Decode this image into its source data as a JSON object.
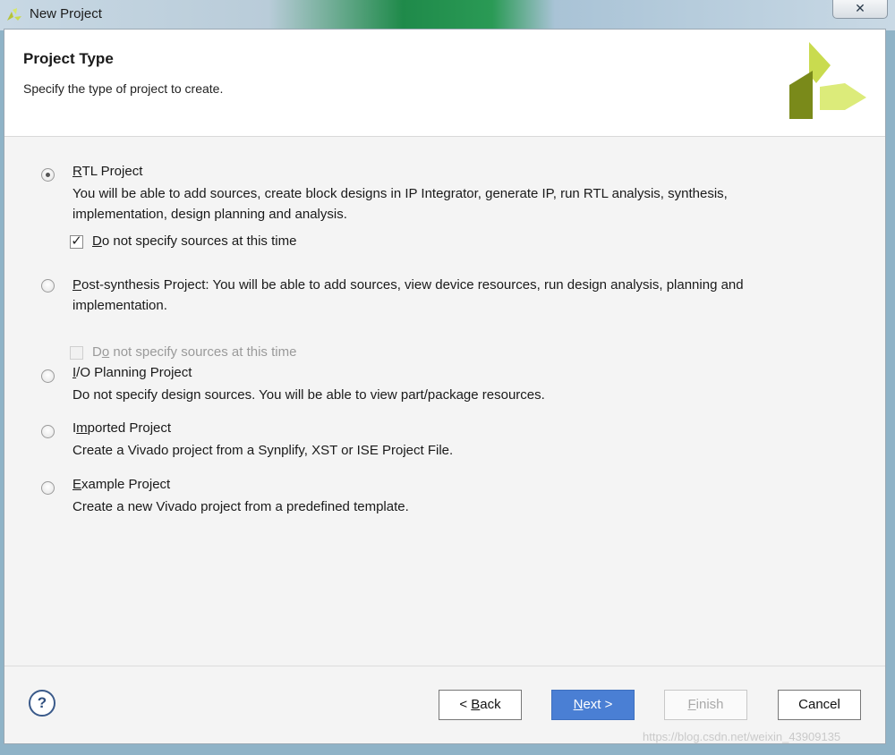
{
  "window": {
    "title": "New Project",
    "close_glyph": "✕"
  },
  "header": {
    "title": "Project Type",
    "subtitle": "Specify the type of project to create.",
    "logo_icon": "vivado-logo-icon"
  },
  "options": [
    {
      "key": "R",
      "title_rest": "TL Project",
      "desc": "You will be able to add sources, create block designs in IP Integrator, generate IP, run RTL analysis, synthesis, implementation, design planning and analysis.",
      "selected": true,
      "checkbox": {
        "key": "D",
        "label_rest": "o not specify sources at this time",
        "checked": true,
        "enabled": true
      }
    },
    {
      "key": "P",
      "title_rest": "ost-synthesis Project: You will be able to add sources, view device resources, run design analysis, planning and implementation.",
      "selected": false,
      "checkbox": {
        "pre": "D",
        "key": "o",
        "label_rest": " not specify sources at this time",
        "checked": false,
        "enabled": false
      }
    },
    {
      "key": "I",
      "title_rest": "/O Planning Project",
      "desc": "Do not specify design sources. You will be able to view part/package resources.",
      "selected": false
    },
    {
      "pre": "I",
      "key": "m",
      "title_rest": "ported Project",
      "desc": "Create a Vivado project from a Synplify, XST or ISE Project File.",
      "selected": false
    },
    {
      "key": "E",
      "title_rest": "xample Project",
      "desc": "Create a new Vivado project from a predefined template.",
      "selected": false
    }
  ],
  "footer": {
    "help": "?",
    "back": {
      "pre": "< ",
      "key": "B",
      "rest": "ack"
    },
    "next": {
      "key": "N",
      "rest": "ext >"
    },
    "finish": {
      "key": "F",
      "rest": "inish"
    },
    "cancel": "Cancel"
  },
  "watermark": "https://blog.csdn.net/weixin_43909135",
  "colors": {
    "accent": "#4a7fd4",
    "logo_dark": "#7a8a1a",
    "logo_light": "#d6e86a"
  }
}
